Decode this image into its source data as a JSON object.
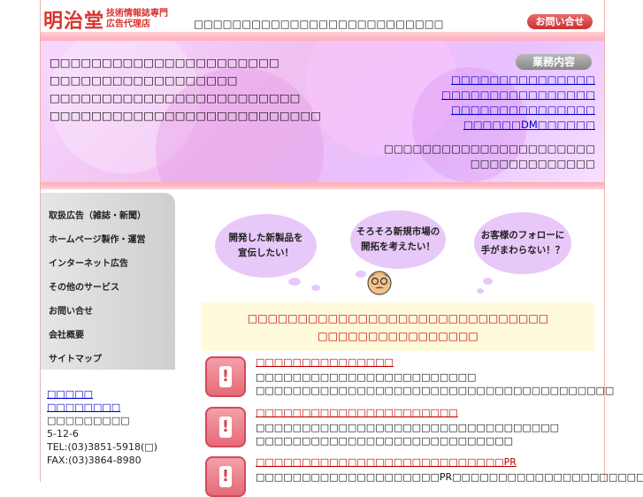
{
  "header": {
    "logo_main": "明治堂",
    "logo_sub_line1": "技術情報誌専門",
    "logo_sub_line2": "広告代理店",
    "tagline": "□□□□□□□□□□□□□□□□□□□□□□□□□□",
    "contact_button": "お問い合せ"
  },
  "banner": {
    "lines": [
      "□□□□□□□□□□□□□□□□□□□□□□",
      "□□□□□□□□□□□□□□□□□□",
      "□□□□□□□□□□□□□□□□□□□□□□□□",
      "□□□□□□□□□□□□□□□□□□□□□□□□□□"
    ],
    "services_heading": "業務内容",
    "services": [
      "□□□□□□□□□□□□□□□",
      "□□□□□□□□□□□□□□□□",
      "□□□□□□□□□□□□□□□",
      "□□□□□□DM□□□□□□"
    ],
    "note_line1": "□□□□□□□□□□□□□□□□□□□□□□",
    "note_line2": "□□□□□□□□□□□□□"
  },
  "sidebar": {
    "items": [
      "取扱広告（雑誌・新聞）",
      "ホームページ製作・運営",
      "インターネット広告",
      "その他のサービス",
      "お問い合せ",
      "会社概要",
      "サイトマップ"
    ]
  },
  "company": {
    "link1": "□□□□□",
    "link2": "□□□□□□□□",
    "name": "□□□□□□□□□",
    "address": "5-12-6",
    "tel": "TEL:(03)3851-5918(□)",
    "fax": "FAX:(03)3864-8980"
  },
  "bubbles": {
    "b1_line1": "開発した新製品を",
    "b1_line2": "宣伝したい！",
    "b2_line1": "そろそろ新規市場の",
    "b2_line2": "開拓を考えたい！",
    "b3_line1": "お客様のフォローに",
    "b3_line2": "手がまわらない！？"
  },
  "callout": {
    "line1": "□□□□□□□□□□□□□□□□□□□□□□□□□□□□□□",
    "line2": "□□□□□□□□□□□□□□□□"
  },
  "features": [
    {
      "title": "□□□□□□□□□□□□□□□",
      "desc": "□□□□□□□□□□□□□□□□□□□□□□□□ □□□□□□□□□□□□□□□□□□□□□□□□□□□□□□□□□□□□□□□"
    },
    {
      "title": "□□□□□□□□□□□□□□□□□□□□□□",
      "desc": "□□□□□□□□□□□□□□□□□□□□□□□□□□□□□□□□□ □□□□□□□□□□□□□□□□□□□□□□□□□□□□"
    },
    {
      "title": "□□□□□□□□□□□□□□□□□□□□□□□□□□□PR",
      "desc": "□□□□□□□□□□□□□□□□□□□□PR□□□□□□□□□□□□□□□□□□□□□"
    }
  ],
  "colors": {
    "brand_red": "#d8342e",
    "pink_bar": "#ffaab5",
    "link_blue": "#0000cc",
    "callout_bg": "#fffadc"
  }
}
